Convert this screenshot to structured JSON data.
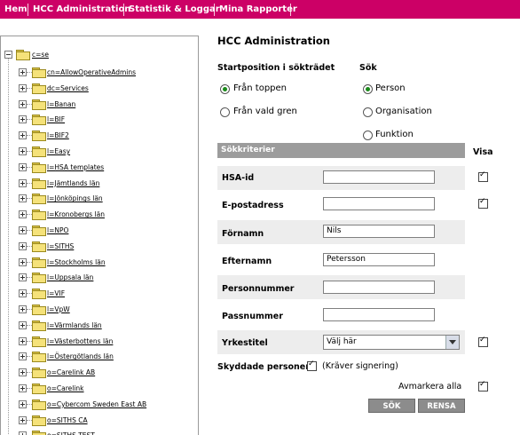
{
  "nav": {
    "items": [
      "Hem",
      "HCC Administration",
      "Statistik & Loggar",
      "Mina Rapporter"
    ]
  },
  "tree": {
    "root": "c=se",
    "children": [
      "cn=AllowOperativeAdmins",
      "dc=Services",
      "l=Banan",
      "l=BIF",
      "l=BIF2",
      "l=Easy",
      "l=HSA templates",
      "l=Jämtlands län",
      "l=Jönköpings län",
      "l=Kronobergs län",
      "l=NPO",
      "l=SITHS",
      "l=Stockholms län",
      "l=Uppsala län",
      "l=VIF",
      "l=VpW",
      "l=Värmlands län",
      "l=Västerbottens län",
      "l=Östergötlands län",
      "o=Carelink AB",
      "o=Carelink",
      "o=Cybercom Sweden East AB",
      "o=SITHS CA",
      "o=SITHS TEST"
    ]
  },
  "form": {
    "title": "HCC Administration",
    "start_label": "Startposition i sökträdet",
    "start_options": [
      "Från toppen",
      "Från vald gren"
    ],
    "start_selected": 0,
    "search_label": "Sök",
    "search_options": [
      "Person",
      "Organisation",
      "Funktion"
    ],
    "search_selected": 0,
    "criteria_header": "Sökkriterier",
    "visa_label": "Visa",
    "fields": [
      {
        "label": "HSA-id",
        "value": "",
        "visa": true
      },
      {
        "label": "E-postadress",
        "value": "",
        "visa": true
      },
      {
        "label": "Förnamn",
        "value": "Nils",
        "visa": false
      },
      {
        "label": "Efternamn",
        "value": "Petersson",
        "visa": false
      },
      {
        "label": "Personnummer",
        "value": "",
        "visa": false
      },
      {
        "label": "Passnummer",
        "value": "",
        "visa": false
      }
    ],
    "yrkestitel": {
      "label": "Yrkestitel",
      "selected": "Välj här",
      "visa": true
    },
    "protected": {
      "label": "Skyddade personer",
      "checked": true,
      "note": "(Kräver signering)"
    },
    "deselect_label": "Avmarkera alla",
    "deselect_checked": true,
    "buttons": {
      "search": "SÖK",
      "clear": "RENSA"
    }
  }
}
